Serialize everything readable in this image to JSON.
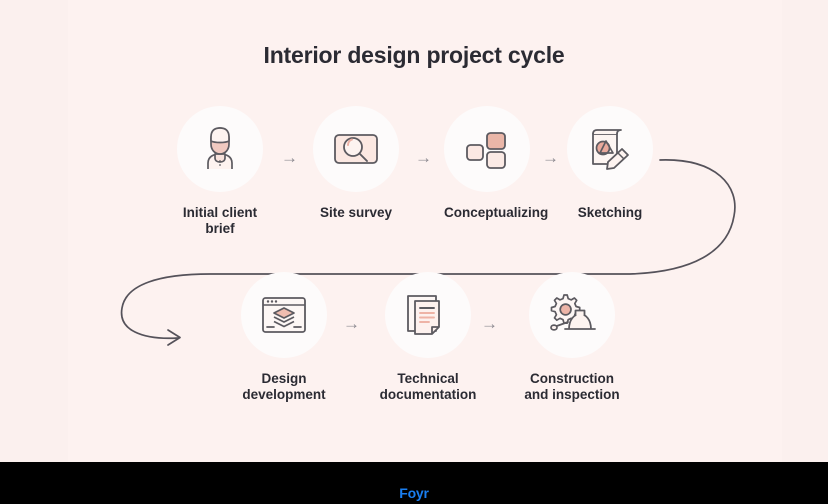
{
  "page": {
    "title": "Interior design project cycle",
    "background_color": "#fbf0ee",
    "panel_color": "#fdf2f0",
    "text_color": "#2b2b33"
  },
  "diagram": {
    "connector_symbol": "→",
    "loop_arrow_name": "cycle-loop-arrow",
    "row_top": [
      {
        "id": "initial-client-brief",
        "label": "Initial client\nbrief",
        "icon": "client-person-icon"
      },
      {
        "id": "site-survey",
        "label": "Site survey",
        "icon": "magnifier-survey-icon"
      },
      {
        "id": "conceptualizing",
        "label": "Conceptualizing",
        "icon": "blocks-concept-icon"
      },
      {
        "id": "sketching",
        "label": "Sketching",
        "icon": "sketchpad-pencil-icon"
      }
    ],
    "row_bottom": [
      {
        "id": "design-development",
        "label": "Design\ndevelopment",
        "icon": "layers-window-icon"
      },
      {
        "id": "technical-documentation",
        "label": "Technical\ndocumentation",
        "icon": "documents-icon"
      },
      {
        "id": "construction-and-inspection",
        "label": "Construction\nand inspection",
        "icon": "gear-hardhat-icon"
      }
    ]
  },
  "footer": {
    "logo_text": "Foyr",
    "logo_color": "#1a7ef0",
    "bar_color": "#000000"
  }
}
